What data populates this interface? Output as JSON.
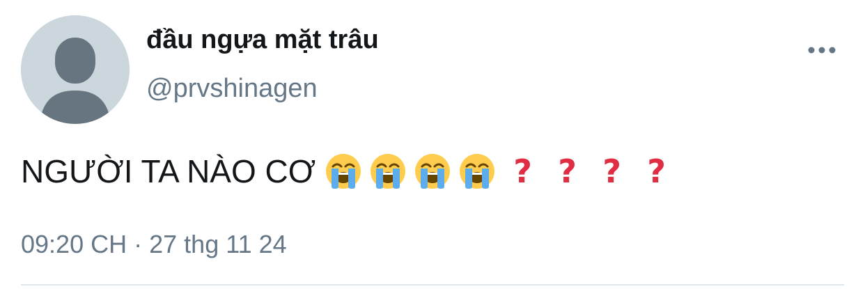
{
  "author": {
    "display_name": "đầu ngựa mặt trâu",
    "handle": "@prvshinagen"
  },
  "more_icon": "more-horizontal-icon",
  "tweet": {
    "text": "NGƯỜI TA NÀO CƠ",
    "emojis": [
      "loudly-crying-face",
      "loudly-crying-face",
      "loudly-crying-face",
      "loudly-crying-face"
    ],
    "question_marks": [
      "?",
      "?",
      "?",
      "?"
    ],
    "accent_color": "#dd2e44"
  },
  "meta": {
    "time": "09:20 CH",
    "separator": "·",
    "date": "27 thg 11 24"
  },
  "colors": {
    "text": "#14171a",
    "secondary": "#657786",
    "avatar_bg": "#ccd6dd",
    "avatar_fg": "#66757f",
    "divider": "#e1e8ed"
  }
}
